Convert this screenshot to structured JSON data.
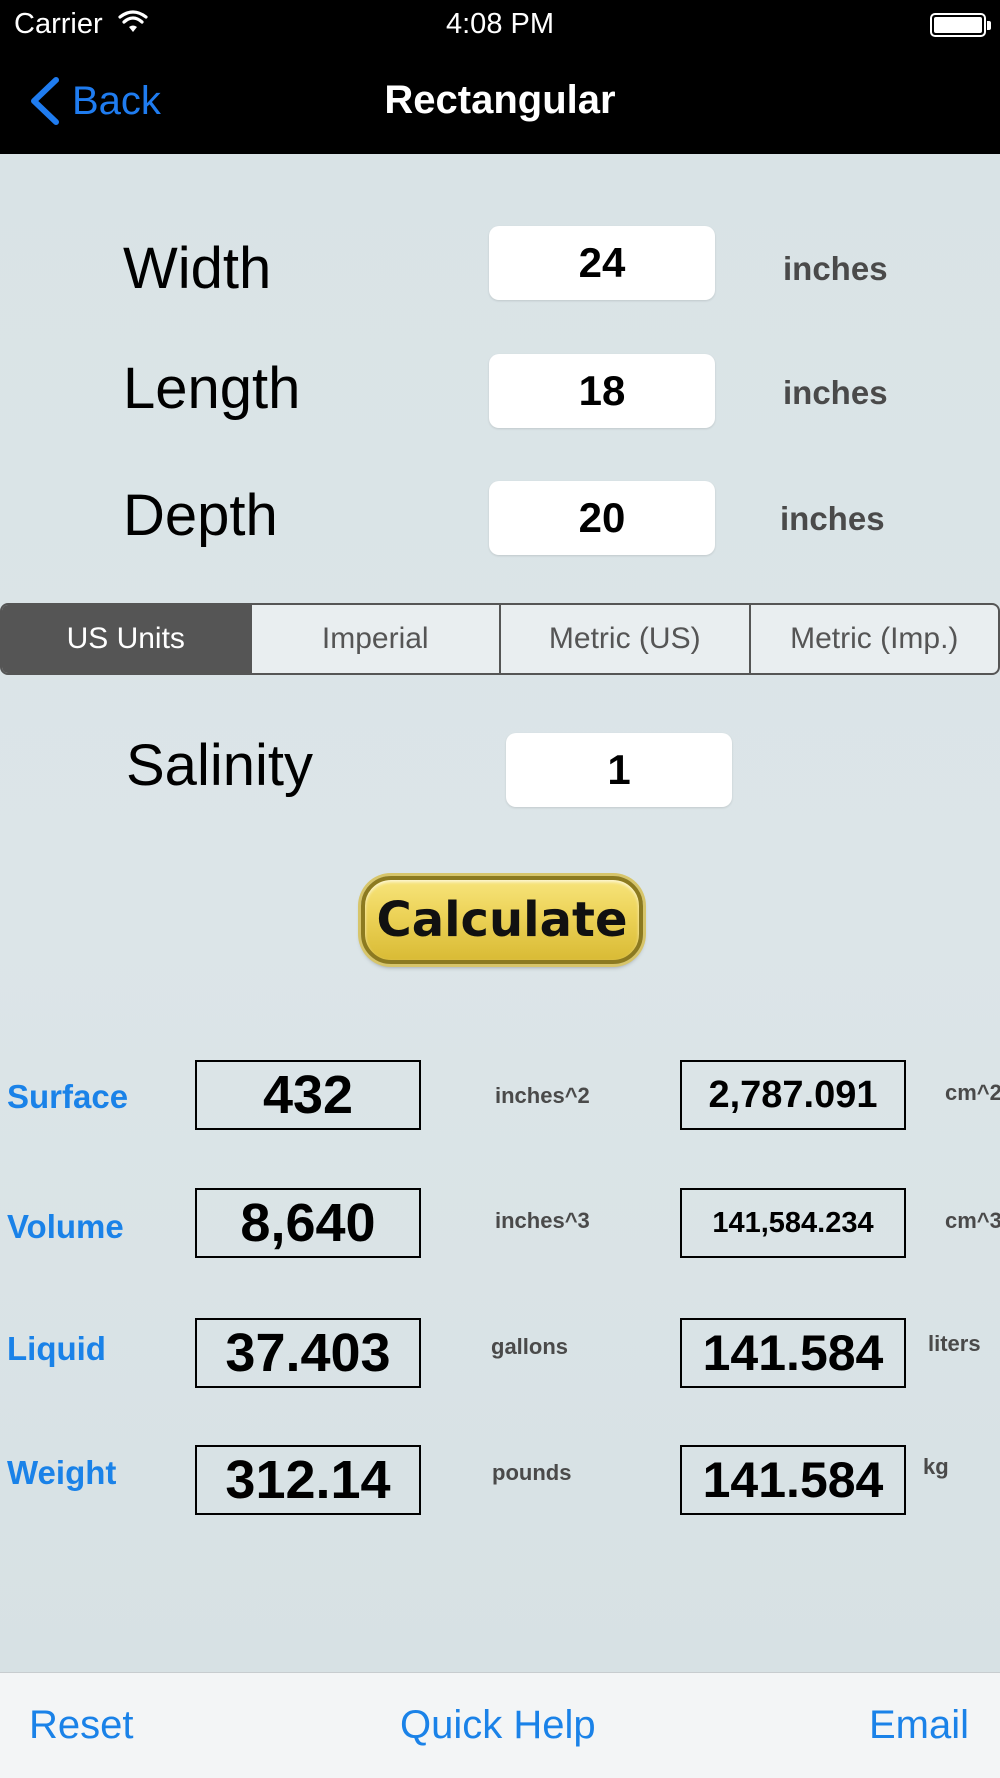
{
  "status_bar": {
    "carrier": "Carrier",
    "time": "4:08 PM"
  },
  "nav": {
    "back_label": "Back",
    "title": "Rectangular"
  },
  "dimensions": {
    "width": {
      "label": "Width",
      "value": "24",
      "unit": "inches"
    },
    "length": {
      "label": "Length",
      "value": "18",
      "unit": "inches"
    },
    "depth": {
      "label": "Depth",
      "value": "20",
      "unit": "inches"
    }
  },
  "units_segments": [
    {
      "label": "US Units",
      "selected": true
    },
    {
      "label": "Imperial",
      "selected": false
    },
    {
      "label": "Metric (US)",
      "selected": false
    },
    {
      "label": "Metric (Imp.)",
      "selected": false
    }
  ],
  "salinity": {
    "label": "Salinity",
    "value": "1"
  },
  "calculate_label": "Calculate",
  "results": [
    {
      "label": "Surface",
      "value": "432",
      "unit": "inches^2",
      "metric_value": "2,787.091",
      "metric_unit": "cm^2"
    },
    {
      "label": "Volume",
      "value": "8,640",
      "unit": "inches^3",
      "metric_value": "141,584.234",
      "metric_unit": "cm^3"
    },
    {
      "label": "Liquid",
      "value": "37.403",
      "unit": "gallons",
      "metric_value": "141.584",
      "metric_unit": "liters"
    },
    {
      "label": "Weight",
      "value": "312.14",
      "unit": "pounds",
      "metric_value": "141.584",
      "metric_unit": "kg"
    }
  ],
  "toolbar": {
    "reset_label": "Reset",
    "help_label": "Quick Help",
    "email_label": "Email"
  },
  "colors": {
    "accent": "#1a82e8",
    "nav_back": "#1f7cf0",
    "segment_selected": "#555555",
    "button_gold": "#ecd257"
  }
}
